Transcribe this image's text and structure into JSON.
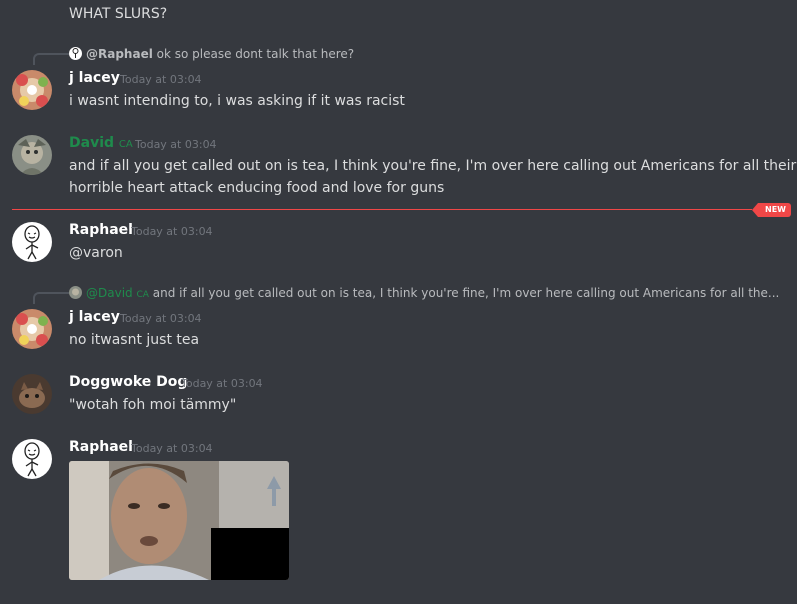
{
  "messages": {
    "m0": {
      "text": "WHAT SLURS?"
    },
    "m1": {
      "reply": {
        "name": "@Raphael",
        "text": "ok so please dont talk that here?"
      },
      "author": "j lacey",
      "time": "Today at 03:04",
      "text": "i wasnt intending to, i was asking if it was racist"
    },
    "m2": {
      "author": "David",
      "tag": "CA",
      "time": "Today at 03:04",
      "text_line1": "and if all you get called out on is tea, I think you're fine, I'm over here calling out Americans for all their",
      "text_line2": "horrible heart attack enducing food and love for guns"
    },
    "divider": {
      "badge": "NEW"
    },
    "m3": {
      "author": "Raphael",
      "time": "Today at 03:04",
      "text": "@varon"
    },
    "m4": {
      "reply": {
        "name": "@David",
        "tag": "CA",
        "text": "and if all you get called out on is tea, I think you're fine, I'm over here calling out Americans for all the..."
      },
      "author": "j lacey",
      "time": "Today at 03:04",
      "text": "no itwasnt just tea"
    },
    "m5": {
      "author": "Doggwoke Dog",
      "time": "Today at 03:04",
      "text": "\"wotah foh moi tämmy\""
    },
    "m6": {
      "author": "Raphael",
      "time": "Today at 03:04"
    }
  },
  "colors": {
    "background": "#36393f",
    "username": "#ffffff",
    "david_role": "#1f8b4c",
    "timestamp": "#72767d",
    "new_divider": "#f04747"
  },
  "icons": {
    "raphael_avatar": "rage-comic-avatar",
    "jlacey_avatar": "flower-avatar",
    "david_avatar": "illustration-avatar",
    "doggwoke_avatar": "cat-photo-avatar"
  }
}
